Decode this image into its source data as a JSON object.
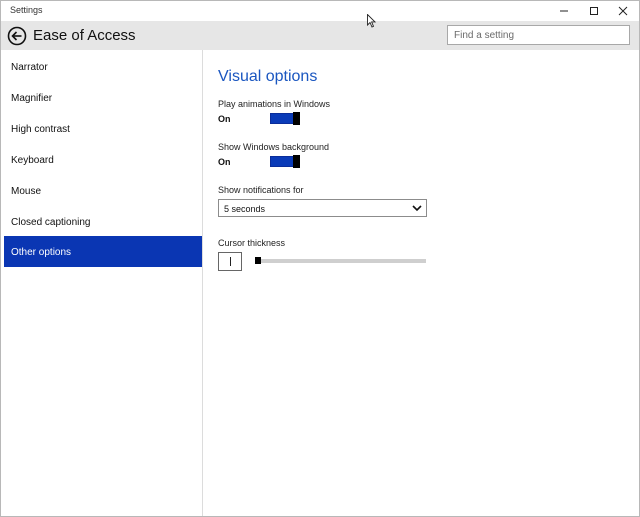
{
  "window": {
    "title": "Settings"
  },
  "header": {
    "app_title": "Ease of Access",
    "search_placeholder": "Find a setting"
  },
  "sidebar": {
    "items": [
      {
        "label": "Narrator",
        "active": false
      },
      {
        "label": "Magnifier",
        "active": false
      },
      {
        "label": "High contrast",
        "active": false
      },
      {
        "label": "Keyboard",
        "active": false
      },
      {
        "label": "Mouse",
        "active": false
      },
      {
        "label": "Closed captioning",
        "active": false
      },
      {
        "label": "Other options",
        "active": true
      }
    ]
  },
  "main": {
    "section_title": "Visual options",
    "animations": {
      "label": "Play animations in Windows",
      "state": "On"
    },
    "background": {
      "label": "Show Windows background",
      "state": "On"
    },
    "notifications": {
      "label": "Show notifications for",
      "selected": "5 seconds"
    },
    "cursor": {
      "label": "Cursor thickness",
      "value_fraction": 0.0
    }
  },
  "colors": {
    "accent": "#0a36b3",
    "title_blue": "#1a56c0",
    "header_bg": "#e6e6e6"
  },
  "icons": [
    "back-arrow-icon",
    "minimize-icon",
    "maximize-icon",
    "close-icon",
    "chevron-down-icon",
    "mouse-pointer-icon"
  ]
}
